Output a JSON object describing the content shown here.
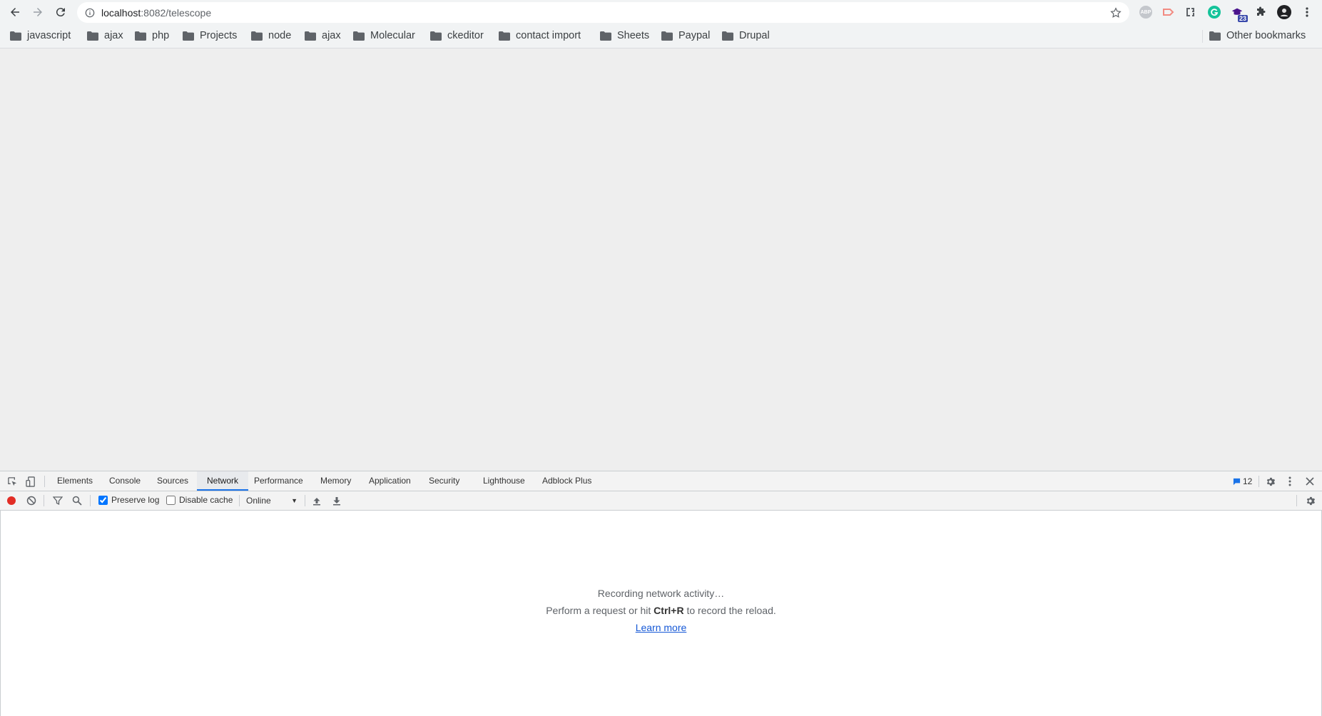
{
  "browser": {
    "url_host": "localhost",
    "url_rest": ":8082/telescope",
    "extensions": [
      "adblock-plus-icon",
      "cast-icon",
      "css-icon",
      "grammarly-icon",
      "tab-counter-icon",
      "extensions-puzzle-icon",
      "profile-avatar",
      "menu-icon"
    ],
    "ext_badge": "23"
  },
  "bookmarks": {
    "items": [
      "javascript",
      "ajax",
      "php",
      "Projects",
      "node",
      "ajax",
      "Molecular",
      "ckeditor",
      "contact import",
      "Sheets",
      "Paypal",
      "Drupal"
    ],
    "other": "Other bookmarks"
  },
  "devtools": {
    "tabs": [
      "Elements",
      "Console",
      "Sources",
      "Network",
      "Performance",
      "Memory",
      "Application",
      "Security",
      "Lighthouse",
      "Adblock Plus"
    ],
    "active_tab": "Network",
    "issues_count": "12",
    "preserve_log_label": "Preserve log",
    "preserve_log_checked": true,
    "disable_cache_label": "Disable cache",
    "disable_cache_checked": false,
    "throttle_value": "Online",
    "empty": {
      "recording": "Recording network activity…",
      "hint_pre": "Perform a request or hit ",
      "hint_key": "Ctrl+R",
      "hint_post": " to record the reload.",
      "learn_more": "Learn more"
    }
  },
  "colors": {
    "accent": "#1a73e8",
    "record": "#e22d25"
  }
}
